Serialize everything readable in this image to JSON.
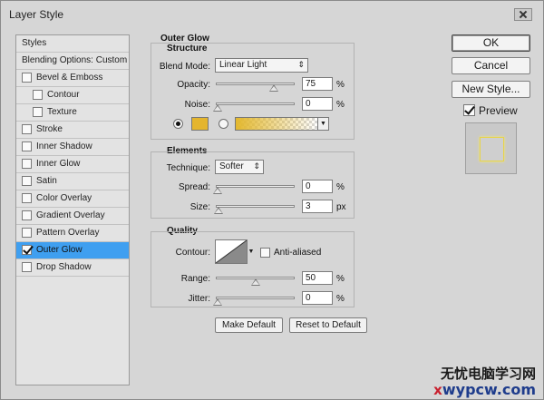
{
  "window": {
    "title": "Layer Style"
  },
  "left_list": {
    "items": [
      {
        "label": "Styles",
        "checkbox": false
      },
      {
        "label": "Blending Options: Custom",
        "checkbox": false
      },
      {
        "label": "Bevel & Emboss",
        "checkbox": true,
        "checked": false
      },
      {
        "label": "Contour",
        "checkbox": true,
        "checked": false,
        "indent": true
      },
      {
        "label": "Texture",
        "checkbox": true,
        "checked": false,
        "indent": true
      },
      {
        "label": "Stroke",
        "checkbox": true,
        "checked": false
      },
      {
        "label": "Inner Shadow",
        "checkbox": true,
        "checked": false
      },
      {
        "label": "Inner Glow",
        "checkbox": true,
        "checked": false
      },
      {
        "label": "Satin",
        "checkbox": true,
        "checked": false
      },
      {
        "label": "Color Overlay",
        "checkbox": true,
        "checked": false
      },
      {
        "label": "Gradient Overlay",
        "checkbox": true,
        "checked": false
      },
      {
        "label": "Pattern Overlay",
        "checkbox": true,
        "checked": false
      },
      {
        "label": "Outer Glow",
        "checkbox": true,
        "checked": true,
        "selected": true
      },
      {
        "label": "Drop Shadow",
        "checkbox": true,
        "checked": false
      }
    ]
  },
  "outer_glow": {
    "heading": "Outer Glow",
    "structure": {
      "heading": "Structure",
      "blend_mode_label": "Blend Mode:",
      "blend_mode_value": "Linear Light",
      "opacity_label": "Opacity:",
      "opacity_value": "75",
      "opacity_unit": "%",
      "opacity_level": 0.75,
      "noise_label": "Noise:",
      "noise_value": "0",
      "noise_unit": "%",
      "noise_level": 0.0,
      "glow_color": "#e4b52d",
      "color_mode": "solid"
    },
    "elements": {
      "heading": "Elements",
      "technique_label": "Technique:",
      "technique_value": "Softer",
      "spread_label": "Spread:",
      "spread_value": "0",
      "spread_unit": "%",
      "spread_level": 0.0,
      "size_label": "Size:",
      "size_value": "3",
      "size_unit": "px",
      "size_level": 0.01
    },
    "quality": {
      "heading": "Quality",
      "contour_label": "Contour:",
      "anti_aliased_label": "Anti-aliased",
      "anti_aliased_checked": false,
      "range_label": "Range:",
      "range_value": "50",
      "range_unit": "%",
      "range_level": 0.5,
      "jitter_label": "Jitter:",
      "jitter_value": "0",
      "jitter_unit": "%",
      "jitter_level": 0.0
    },
    "make_default_label": "Make Default",
    "reset_default_label": "Reset to Default"
  },
  "right_panel": {
    "ok_label": "OK",
    "cancel_label": "Cancel",
    "new_style_label": "New Style...",
    "preview_label": "Preview",
    "preview_checked": true
  },
  "watermark": {
    "line1": "无忧电脑学习网",
    "line2_prefix": "x",
    "line2_url": "wypcw.com"
  }
}
